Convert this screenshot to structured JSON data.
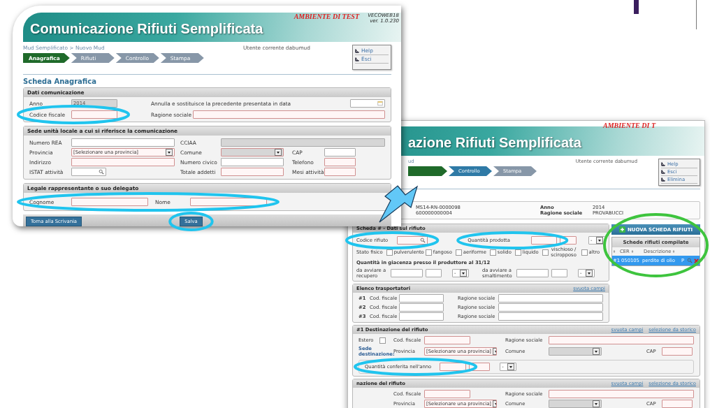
{
  "front_window": {
    "title": "Comunicazione Rifiuti Semplificata",
    "environment": "AMBIENTE DI TEST",
    "version": [
      "VECOWEB18",
      "ver. 1.0.230"
    ],
    "breadcrumb": "Mud Semplificato > Nuovo Mud",
    "current_user": "Utente corrente dabumud",
    "steps": [
      {
        "label": "Anagrafica",
        "color": "#1f6a2a"
      },
      {
        "label": "Rifiuti",
        "color": "#8797a8"
      },
      {
        "label": "Controllo",
        "color": "#8797a8"
      },
      {
        "label": "Stampa",
        "color": "#8797a8"
      }
    ],
    "links": [
      "Help",
      "Esci"
    ],
    "heading": "Scheda Anagrafica",
    "sections": [
      {
        "title": "Dati comunicazione",
        "fields": [
          {
            "label": "Anno",
            "kind": "text",
            "value": "2014",
            "disabled": true,
            "required": false
          },
          {
            "label": "Annulla e sostituisce la precedente presentata in data",
            "kind": "date",
            "disabled": false,
            "required": false
          },
          {
            "label": "Codice fiscale",
            "kind": "text",
            "disabled": false,
            "required": true
          },
          {
            "label": "Ragione sociale",
            "kind": "text",
            "disabled": false,
            "required": true
          }
        ]
      },
      {
        "title": "Sede unità locale a cui si riferisce la comunicazione",
        "fields": [
          {
            "label": "Numero REA",
            "kind": "text",
            "disabled": false,
            "required": false
          },
          {
            "label": "CCIAA",
            "kind": "text",
            "disabled": true,
            "required": false
          },
          {
            "label": "Provincia",
            "kind": "select",
            "value": "[Selezionare una provincia]",
            "disabled": false,
            "required": true
          },
          {
            "label": "Comune",
            "kind": "select",
            "disabled": true,
            "required": true
          },
          {
            "label": "CAP",
            "kind": "text",
            "disabled": false,
            "required": false
          },
          {
            "label": "Indirizzo",
            "kind": "text",
            "disabled": false,
            "required": true
          },
          {
            "label": "Numero civico",
            "kind": "text",
            "disabled": false,
            "required": false
          },
          {
            "label": "Telefono",
            "kind": "text",
            "disabled": false,
            "required": true
          },
          {
            "label": "ISTAT attività",
            "kind": "search",
            "disabled": false,
            "required": false
          },
          {
            "label": "Totale addetti",
            "kind": "text",
            "disabled": false,
            "required": true
          },
          {
            "label": "Mesi attività",
            "kind": "text",
            "disabled": false,
            "required": true
          }
        ]
      },
      {
        "title": "Legale rappresentante o suo delegato",
        "fields": [
          {
            "label": "Cognome",
            "kind": "text",
            "disabled": false,
            "required": true
          },
          {
            "label": "Nome",
            "kind": "text",
            "disabled": false,
            "required": true
          }
        ]
      }
    ],
    "buttons": [
      "Torna alla Scrivania",
      "Salva"
    ]
  },
  "back_window": {
    "title_fragment": "azione Rifiuti Semplificata",
    "environment_fragment": "AMBIENTE DI T",
    "breadcrumb_fragment": "ud",
    "current_user": "Utente corrente dabumud",
    "steps": [
      {
        "color": "#1f6a2a"
      },
      {
        "label": "Controllo",
        "color": "#2f7aa6"
      },
      {
        "label": "Stampa",
        "color": "#8797a8"
      }
    ],
    "links": [
      "Help",
      "Esci",
      "Elimina"
    ],
    "summary": {
      "codes": [
        "MS14-RN-0000098",
        "600000000004"
      ],
      "pairs": [
        {
          "label": "Anno",
          "value": "2014"
        },
        {
          "label": "Ragione sociale",
          "value": "PROVABUCCI"
        }
      ]
    },
    "waste_section": {
      "title": "Scheda # - Dati sul rifiuto",
      "code_label": "Codice rifiuto",
      "quantity_label": "Quantità prodotta",
      "unit_value": "-",
      "state_label": "Stato fisico",
      "states": [
        {
          "label": "pulverulento",
          "checked": false
        },
        {
          "label": "fangoso",
          "checked": false
        },
        {
          "label": "aeriforme",
          "checked": false
        },
        {
          "label": "solido",
          "checked": false
        },
        {
          "label": "liquido",
          "checked": false
        },
        {
          "label": "vischioso / sciropposo",
          "checked": false
        },
        {
          "label": "altro",
          "checked": false
        }
      ],
      "stock_title": "Quantità in giacenza presso il produttore al 31/12",
      "stock_fields": [
        {
          "label": "da avviare a recupero",
          "unit": "-"
        },
        {
          "label": "da avviare a smaltimento",
          "unit": "-"
        }
      ]
    },
    "carriers": {
      "title": "Elenco trasportatori",
      "clear_link": "svuota campi",
      "rows": [
        {
          "number": "#1",
          "tax_code_label": "Cod. fiscale",
          "name_label": "Ragione sociale"
        },
        {
          "number": "#2",
          "tax_code_label": "Cod. fiscale",
          "name_label": "Ragione sociale"
        },
        {
          "number": "#3",
          "tax_code_label": "Cod. fiscale",
          "name_label": "Ragione sociale"
        }
      ]
    },
    "destinations": [
      {
        "title": "#1 Destinazione del rifiuto",
        "links": [
          "svuota campi",
          "selezione da storico"
        ],
        "foreign_label": "Estero",
        "foreign_checked": false,
        "tax_code_label": "Cod. fiscale",
        "name_label": "Ragione sociale",
        "site_label": "Sede destinazione:",
        "province_label": "Provincia",
        "province_value": "[Selezionare una provincia]",
        "city_label": "Comune",
        "zip_label": "CAP",
        "quantity_label": "Quantità conferita nell'anno",
        "unit_value": "-"
      },
      {
        "title": "nazione del rifiuto",
        "links": [
          "svuota campi",
          "selezione da storico"
        ],
        "tax_code_label": "Cod. fiscale",
        "name_label": "Ragione sociale",
        "province_label": "Provincia",
        "province_value": "[Selezionare una provincia]",
        "city_label": "Comune",
        "zip_label": "CAP"
      }
    ],
    "new_button": "NUOVA SCHEDA RIFIUTI",
    "list": {
      "title": "Schede rifiuti compilate",
      "columns": [
        "CER",
        "Descrizione"
      ],
      "rows": [
        {
          "number": "#1",
          "code": "050105",
          "description": "perdite di olio",
          "flag": "P",
          "selected": true
        }
      ]
    }
  },
  "annotations": [
    {
      "color": "#20c4ee"
    },
    {
      "color": "#20c4ee"
    },
    {
      "color": "#20c4ee"
    },
    {
      "color": "#20c4ee"
    },
    {
      "color": "#20c4ee"
    },
    {
      "color": "#20c4ee"
    },
    {
      "color": "#3ec43e"
    }
  ]
}
